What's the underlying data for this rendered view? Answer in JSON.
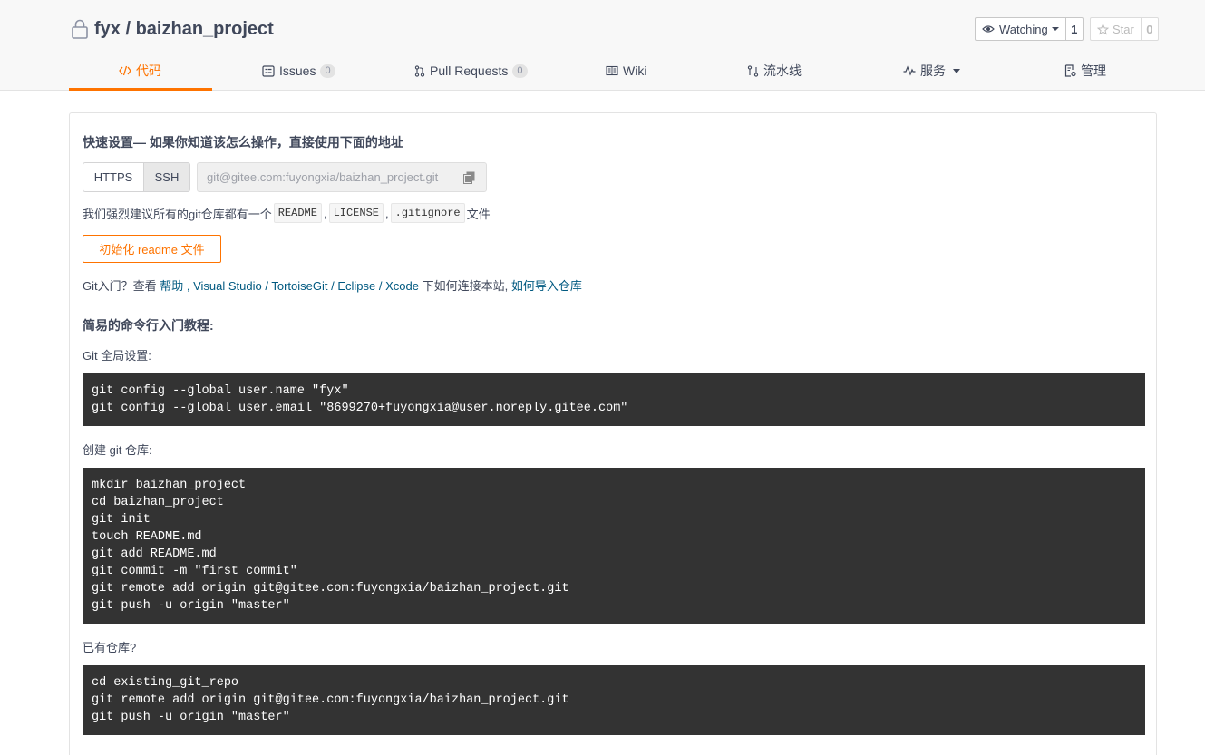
{
  "repo": {
    "owner": "fyx",
    "separator": "/",
    "name": "baizhan_project",
    "full_title": "fyx / baizhan_project"
  },
  "actions": {
    "watch_label": "Watching",
    "watch_count": "1",
    "star_label": "Star",
    "star_count": "0"
  },
  "tabs": [
    {
      "label": "代码",
      "icon": "code-icon",
      "active": true
    },
    {
      "label": "Issues",
      "icon": "issues-icon",
      "count": "0"
    },
    {
      "label": "Pull Requests",
      "icon": "pull-request-icon",
      "count": "0"
    },
    {
      "label": "Wiki",
      "icon": "wiki-icon"
    },
    {
      "label": "流水线",
      "icon": "pipeline-icon"
    },
    {
      "label": "服务",
      "icon": "pulse-icon",
      "dropdown": true
    },
    {
      "label": "管理",
      "icon": "settings-doc-icon"
    }
  ],
  "quick": {
    "title": "快速设置— 如果你知道该怎么操作，直接使用下面的地址",
    "proto_https": "HTTPS",
    "proto_ssh": "SSH",
    "url": "git@gitee.com:fuyongxia/baizhan_project.git",
    "suggest_prefix": "我们强烈建议所有的git仓库都有一个",
    "file_readme": "README",
    "file_license": "LICENSE",
    "file_gitignore": ".gitignore",
    "sep1": ",",
    "sep2": ",",
    "suggest_suffix": "文件",
    "init_button": "初始化 readme 文件"
  },
  "help": {
    "prefix": "Git入门？查看 ",
    "link_help": "帮助",
    "comma": " , ",
    "link_vs": "Visual Studio",
    "slash1": " / ",
    "link_tortoise": "TortoiseGit",
    "slash2": " / ",
    "link_eclipse": "Eclipse",
    "slash3": " / ",
    "link_xcode": "Xcode",
    "middle": " 下如何连接本站, ",
    "link_import": "如何导入仓库"
  },
  "tutorial": {
    "title": "简易的命令行入门教程:",
    "global_label": "Git 全局设置:",
    "global_code": "git config --global user.name \"fyx\"\ngit config --global user.email \"8699270+fuyongxia@user.noreply.gitee.com\"",
    "create_label": "创建 git 仓库:",
    "create_code": "mkdir baizhan_project\ncd baizhan_project\ngit init\ntouch README.md\ngit add README.md\ngit commit -m \"first commit\"\ngit remote add origin git@gitee.com:fuyongxia/baizhan_project.git\ngit push -u origin \"master\"",
    "existing_label": "已有仓库?",
    "existing_code": "cd existing_git_repo\ngit remote add origin git@gitee.com:fuyongxia/baizhan_project.git\ngit push -u origin \"master\""
  },
  "colors": {
    "accent": "#fe7300",
    "link": "#005980",
    "code_bg": "#333333",
    "text": "#40485b"
  }
}
